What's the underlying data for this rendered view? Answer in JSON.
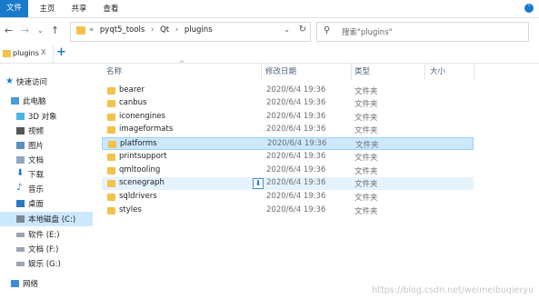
{
  "ribbon": {
    "tabs": [
      "文件",
      "主页",
      "共享",
      "查看"
    ]
  },
  "nav": {
    "breadcrumbs": [
      "pyqt5_tools",
      "Qt",
      "plugins"
    ],
    "search_placeholder": "搜索\"plugins\""
  },
  "tab": {
    "label": "plugins",
    "close": "X",
    "add": "+"
  },
  "sidebar": {
    "items": [
      {
        "label": "快速访问",
        "icon": "star-icon"
      },
      {
        "label": "此电脑",
        "icon": "computer-icon"
      },
      {
        "label": "3D 对象",
        "icon": "3d-objects-icon"
      },
      {
        "label": "视频",
        "icon": "video-icon"
      },
      {
        "label": "图片",
        "icon": "pictures-icon"
      },
      {
        "label": "文档",
        "icon": "documents-icon"
      },
      {
        "label": "下载",
        "icon": "download-icon"
      },
      {
        "label": "音乐",
        "icon": "music-icon"
      },
      {
        "label": "桌面",
        "icon": "desktop-icon"
      },
      {
        "label": "本地磁盘 (C:)",
        "icon": "drive-icon"
      },
      {
        "label": "软件 (E:)",
        "icon": "drive-icon"
      },
      {
        "label": "文档 (F:)",
        "icon": "drive-icon"
      },
      {
        "label": "娱乐 (G:)",
        "icon": "drive-icon"
      },
      {
        "label": "网络",
        "icon": "network-icon"
      }
    ]
  },
  "columns": {
    "name": "名称",
    "modified": "修改日期",
    "type": "类型",
    "size": "大小"
  },
  "files": [
    {
      "name": "bearer",
      "date": "2020/6/4 19:36",
      "type": "文件夹"
    },
    {
      "name": "canbus",
      "date": "2020/6/4 19:36",
      "type": "文件夹"
    },
    {
      "name": "iconengines",
      "date": "2020/6/4 19:36",
      "type": "文件夹"
    },
    {
      "name": "imageformats",
      "date": "2020/6/4 19:36",
      "type": "文件夹"
    },
    {
      "name": "platforms",
      "date": "2020/6/4 19:36",
      "type": "文件夹"
    },
    {
      "name": "printsupport",
      "date": "2020/6/4 19:36",
      "type": "文件夹"
    },
    {
      "name": "qmltooling",
      "date": "2020/6/4 19:36",
      "type": "文件夹"
    },
    {
      "name": "scenegraph",
      "date": "2020/6/4 19:36",
      "type": "文件夹"
    },
    {
      "name": "sqldrivers",
      "date": "2020/6/4 19:36",
      "type": "文件夹"
    },
    {
      "name": "styles",
      "date": "2020/6/4 19:36",
      "type": "文件夹"
    }
  ],
  "watermark": "https://blog.csdn.net/weimeibuqieryu",
  "colors": {
    "accent": "#1979ca",
    "selection": "#cce8ff",
    "hover": "#e5f3ff",
    "folder": "#f2c24a"
  }
}
